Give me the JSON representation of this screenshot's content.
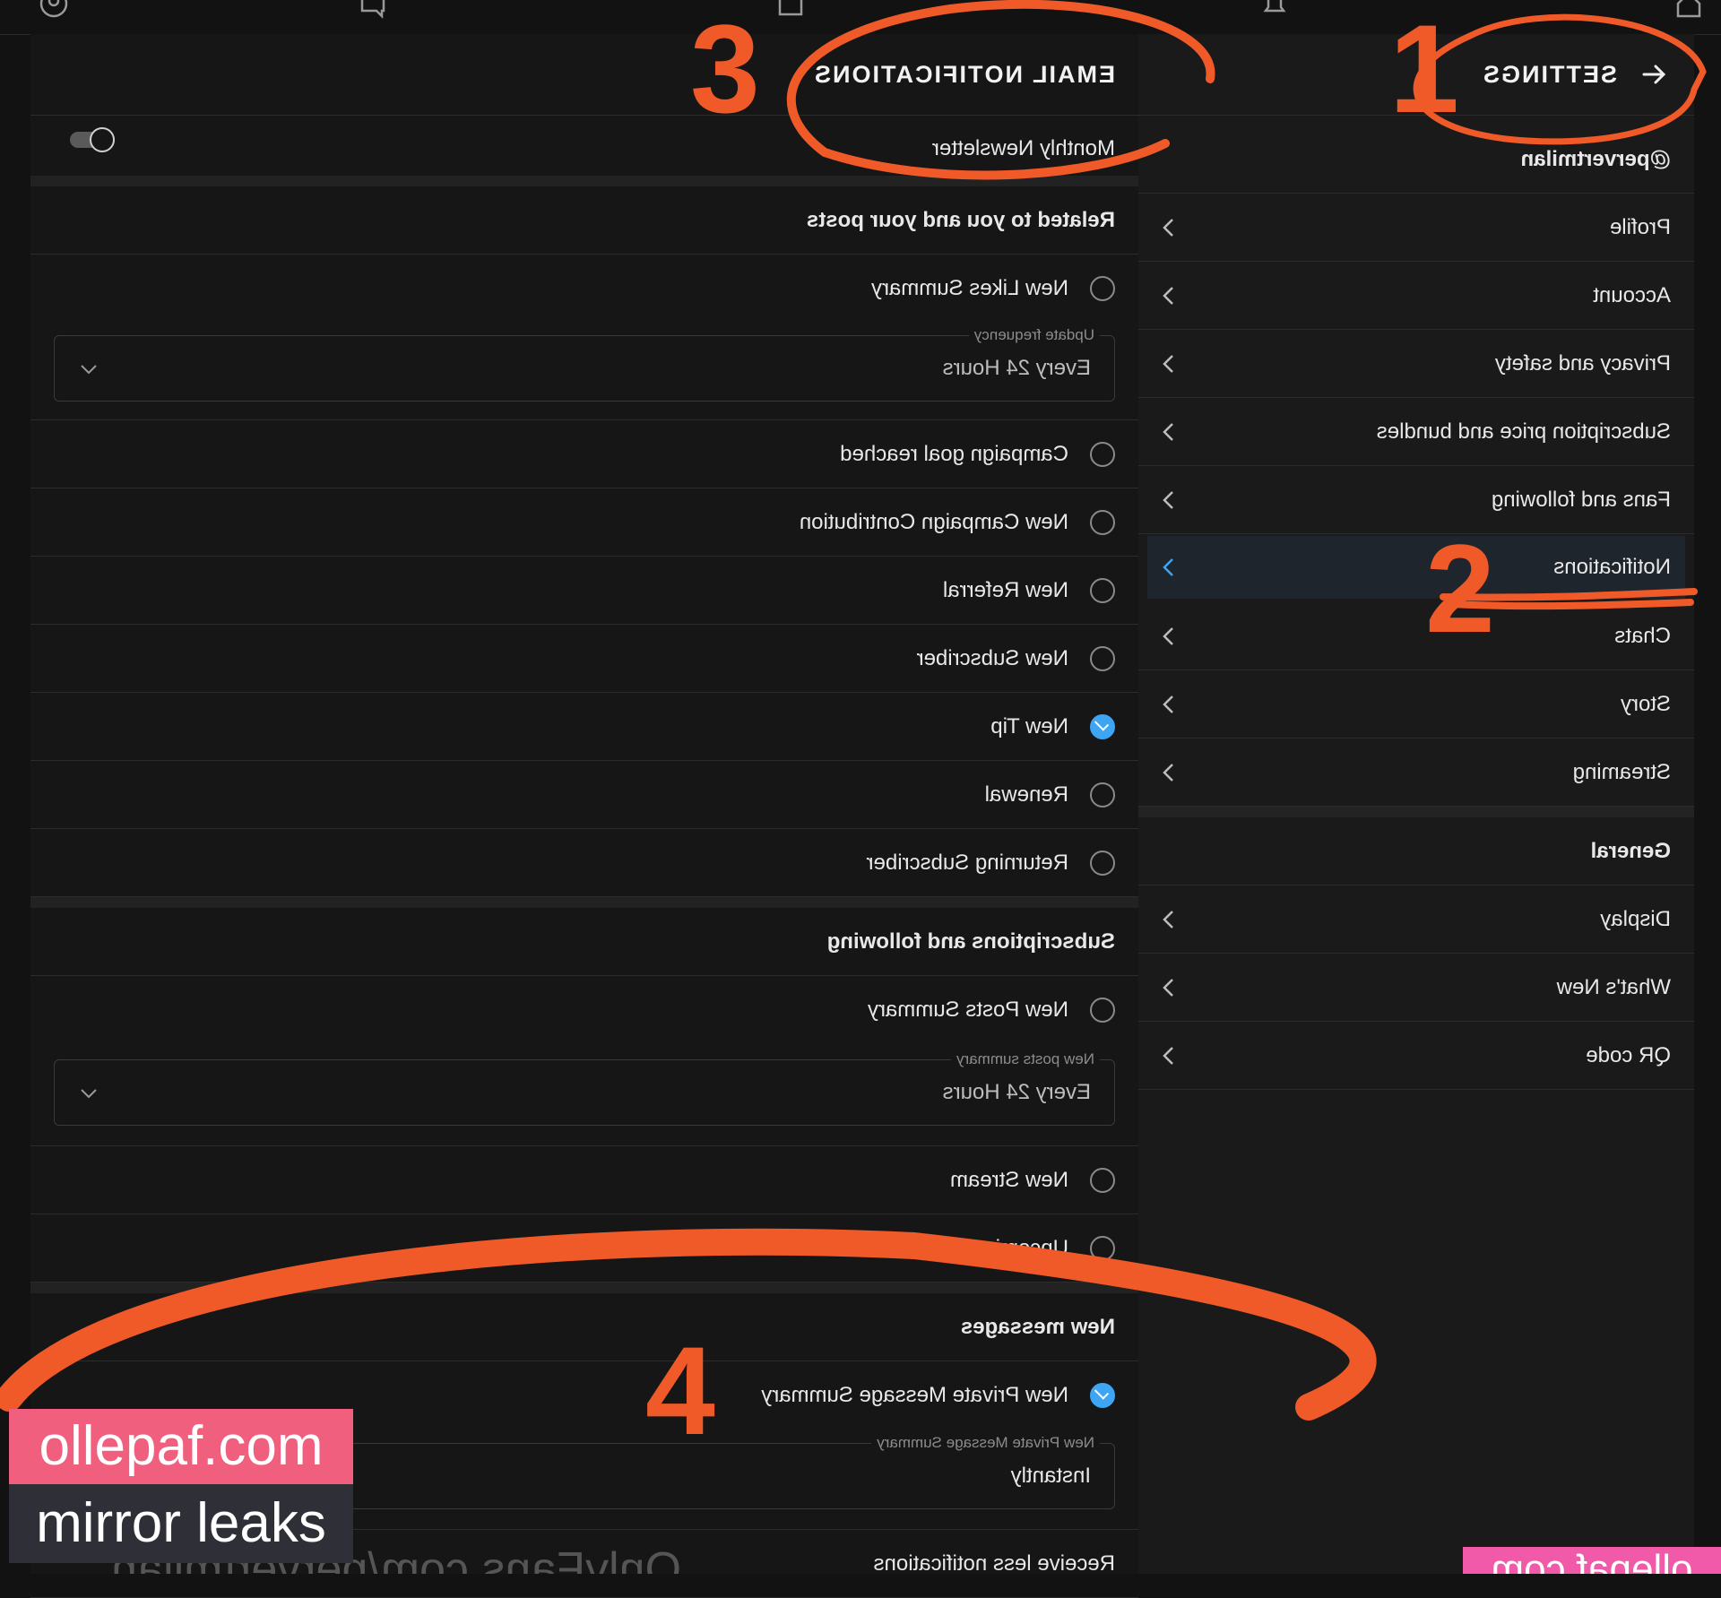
{
  "settings": {
    "title": "SETTINGS",
    "username": "@pervertmilan",
    "items": [
      {
        "label": "Profile"
      },
      {
        "label": "Account"
      },
      {
        "label": "Privacy and safety"
      },
      {
        "label": "Subscription price and bundles"
      },
      {
        "label": "Fans and following"
      },
      {
        "label": "Notifications"
      },
      {
        "label": "Chats"
      },
      {
        "label": "Story"
      },
      {
        "label": "Streaming"
      }
    ],
    "general_heading": "General",
    "general_items": [
      {
        "label": "Display"
      },
      {
        "label": "What's New"
      },
      {
        "label": "QR code"
      }
    ]
  },
  "email": {
    "title": "EMAIL NOTIFICATIONS",
    "monthly_newsletter": "Monthly Newsletter",
    "section_posts": "Related to you and your posts",
    "new_likes_summary": "New Likes Summary",
    "update_frequency_label": "Update frequency",
    "update_frequency_value": "Every 24 Hours",
    "campaign_goal": "Campaign goal reached",
    "new_campaign_contribution": "New Campaign Contribution",
    "new_referral": "New Referral",
    "new_subscriber": "New Subscriber",
    "new_tip": "New Tip",
    "renewal": "Renewal",
    "returning_subscriber": "Returning Subscriber",
    "section_subscriptions": "Subscriptions and following",
    "new_posts_summary": "New Posts Summary",
    "new_posts_summary_label": "New posts summary",
    "new_posts_summary_value": "Every 24 Hours",
    "new_stream": "New Stream",
    "upcoming_stream": "Upcoming stream reminders",
    "section_messages": "New messages",
    "new_private_message_summary": "New Private Message Summary",
    "new_private_message_label": "New Private Message Summary",
    "new_private_message_value": "Instantly",
    "receive_less": "Receive less notifications"
  },
  "annotations": [
    "1",
    "2",
    "3",
    "4"
  ],
  "watermark": {
    "line1": "ollepaf.com",
    "line2": "mirror leaks",
    "bottom_text": "OnlyFans.com/pervertmilan",
    "corner": "ollepaf.com"
  },
  "colors": {
    "accent": "#3da5f4",
    "annotation": "#f05a28",
    "watermark_pink": "#f0607e"
  }
}
